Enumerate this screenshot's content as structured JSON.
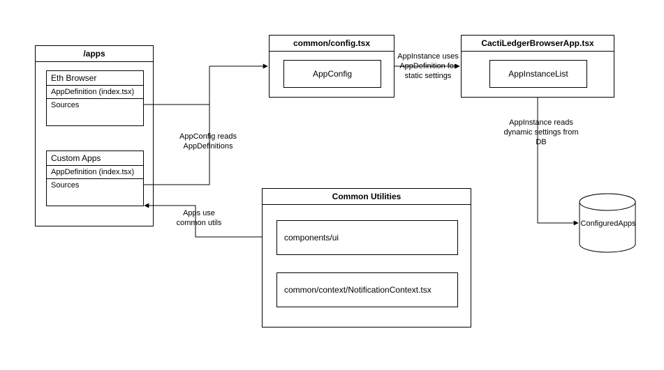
{
  "apps": {
    "title": "/apps",
    "ethBrowser": {
      "title": "Eth Browser",
      "row1": "AppDefinition (index.tsx)",
      "row2": "Sources"
    },
    "customApps": {
      "title": "Custom Apps",
      "row1": "AppDefinition (index.tsx)",
      "row2": "Sources"
    }
  },
  "config": {
    "title": "common/config.tsx",
    "inner": "AppConfig"
  },
  "appFile": {
    "title": "CactiLedgerBrowserApp.tsx",
    "inner": "AppInstanceList"
  },
  "utilities": {
    "title": "Common Utilities",
    "inner1": "components/ui",
    "inner2": "common/context/NotificationContext.tsx"
  },
  "db": {
    "label": "ConfiguredApps"
  },
  "edges": {
    "appsToConfig": "AppConfig reads AppDefinitions",
    "configToApp": "AppInstance uses AppDefinition for static settings",
    "appToDb": "AppInstance reads dynamic settings from DB",
    "utilsToApps": "Apps use common utils"
  }
}
